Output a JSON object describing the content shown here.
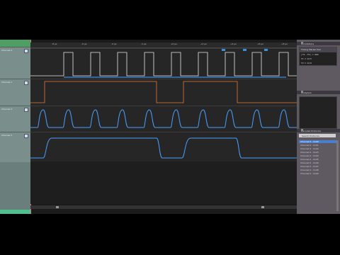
{
  "channels": [
    {
      "label": "Channel 0"
    },
    {
      "label": "Channel 1"
    },
    {
      "label": "Channel 2"
    },
    {
      "label": "Channel 3"
    }
  ],
  "ruler": {
    "ticks": [
      "-8 μs",
      "-6 μs",
      "-4 μs",
      "-2 μs",
      "+0 μs",
      "+2 μs",
      "+4 μs",
      "+6 μs",
      "+8 μs"
    ]
  },
  "side": {
    "measurements": {
      "title": "Annotations",
      "timing_label": "Timing Marker Pair",
      "lines": [
        "| T1 - T2 | = 400",
        "T1 = 12.5",
        "T2 = 12.9"
      ]
    },
    "analyzers": {
      "title": "Analyzers"
    },
    "decoded": {
      "title": "Decoded Protocols",
      "search": "Search Protocols",
      "rows": [
        "Channel 0 - 0x00",
        "Channel 0 - 0x01",
        "Channel 0 - 0x02",
        "Channel 0 - 0x03",
        "Channel 0 - 0x04",
        "Channel 0 - 0x05",
        "Channel 0 - 0x06",
        "Channel 0 - 0x07",
        "Channel 0 - 0x08",
        "Channel 0 - 0x09"
      ]
    }
  },
  "colors": {
    "digital_trace": "#e8e8e8",
    "clock_trace": "#e07a3a",
    "analog_trace": "#4a9fff",
    "measure_bar": "#3a8ee0",
    "channel_panel": "#6a7f7c"
  }
}
